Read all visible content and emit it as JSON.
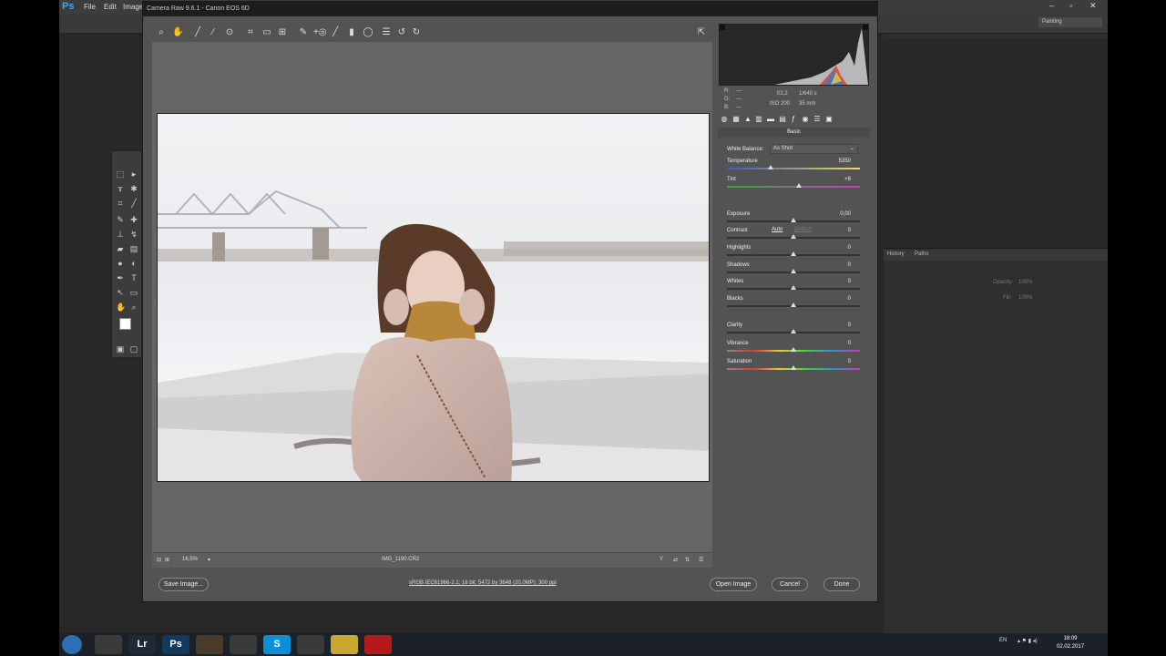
{
  "photoshop": {
    "logo": "Ps",
    "menu": [
      "File",
      "Edit",
      "Image"
    ],
    "workspace": "Painting",
    "window_controls": [
      "–",
      "▫",
      "✕"
    ],
    "panel_tabs": [
      "History",
      "Paths"
    ],
    "opacity_label": "Opacity:",
    "opacity_value": "100%",
    "fill_label": "Fill:",
    "fill_value": "100%"
  },
  "acr": {
    "title": "Camera Raw 9.6.1  -  Canon EOS 6D",
    "toolbar_icons": [
      "zoom-icon",
      "hand-icon",
      "white-balance-icon",
      "color-sampler-icon",
      "target-adjust-icon",
      "crop-icon",
      "straighten-icon",
      "transform-icon",
      "spot-removal-icon",
      "red-eye-icon",
      "adjustment-brush-icon",
      "graduated-filter-icon",
      "radial-filter-icon",
      "preferences-icon",
      "rotate-ccw-icon",
      "rotate-cw-icon"
    ],
    "fullscreen_icon": "fullscreen-icon",
    "meta": {
      "r_label": "R:",
      "g_label": "G:",
      "b_label": "B:",
      "r_value": "---",
      "g_value": "---",
      "b_value": "---",
      "aperture": "f/2,2",
      "shutter": "1/640 s",
      "iso": "ISO 200",
      "focal": "35 mm"
    },
    "panel_title": "Basic",
    "white_balance_label": "White Balance:",
    "white_balance_value": "As Shot",
    "auto_label": "Auto",
    "default_label": "Default",
    "sliders": [
      {
        "name": "Temperature",
        "value": "5350",
        "pos": 0.33
      },
      {
        "name": "Tint",
        "value": "+8",
        "pos": 0.54
      },
      {
        "name": "Exposure",
        "value": "0,00",
        "pos": 0.5
      },
      {
        "name": "Contrast",
        "value": "0",
        "pos": 0.5
      },
      {
        "name": "Highlights",
        "value": "0",
        "pos": 0.5
      },
      {
        "name": "Shadows",
        "value": "0",
        "pos": 0.5
      },
      {
        "name": "Whites",
        "value": "0",
        "pos": 0.5
      },
      {
        "name": "Blacks",
        "value": "0",
        "pos": 0.5
      },
      {
        "name": "Clarity",
        "value": "0",
        "pos": 0.5
      },
      {
        "name": "Vibrance",
        "value": "0",
        "pos": 0.5
      },
      {
        "name": "Saturation",
        "value": "0",
        "pos": 0.5
      }
    ],
    "zoom": "16,5%",
    "filename": "IMG_1190.CR2",
    "workflow_link": "sRGB IEC61966-2.1; 16 bit; 5472 by 3648 (20,0MP); 300 ppi",
    "save_button": "Save Image...",
    "open_button": "Open Image",
    "cancel_button": "Cancel",
    "done_button": "Done"
  },
  "taskbar": {
    "apps": [
      {
        "name": "windows-start-icon",
        "label": "",
        "color": "#2b6fb4"
      },
      {
        "name": "clock-app-icon",
        "label": "",
        "color": "#3a3a3a"
      },
      {
        "name": "lightroom-icon",
        "label": "Lr",
        "color": "#1e2a36"
      },
      {
        "name": "photoshop-icon",
        "label": "Ps",
        "color": "#123a5e"
      },
      {
        "name": "settings-app-icon",
        "label": "",
        "color": "#4a3a2a"
      },
      {
        "name": "chrome-icon",
        "label": "",
        "color": "#3a3a3a"
      },
      {
        "name": "skype-icon",
        "label": "S",
        "color": "#0a8fd8"
      },
      {
        "name": "file-explorer-icon",
        "label": "",
        "color": "#3a3a3a"
      },
      {
        "name": "viewer-app-icon",
        "label": "",
        "color": "#c8a830"
      },
      {
        "name": "acrobat-icon",
        "label": "",
        "color": "#b51a1a"
      }
    ],
    "lang": "EN",
    "time": "18:09",
    "date": "02.02.2017"
  }
}
